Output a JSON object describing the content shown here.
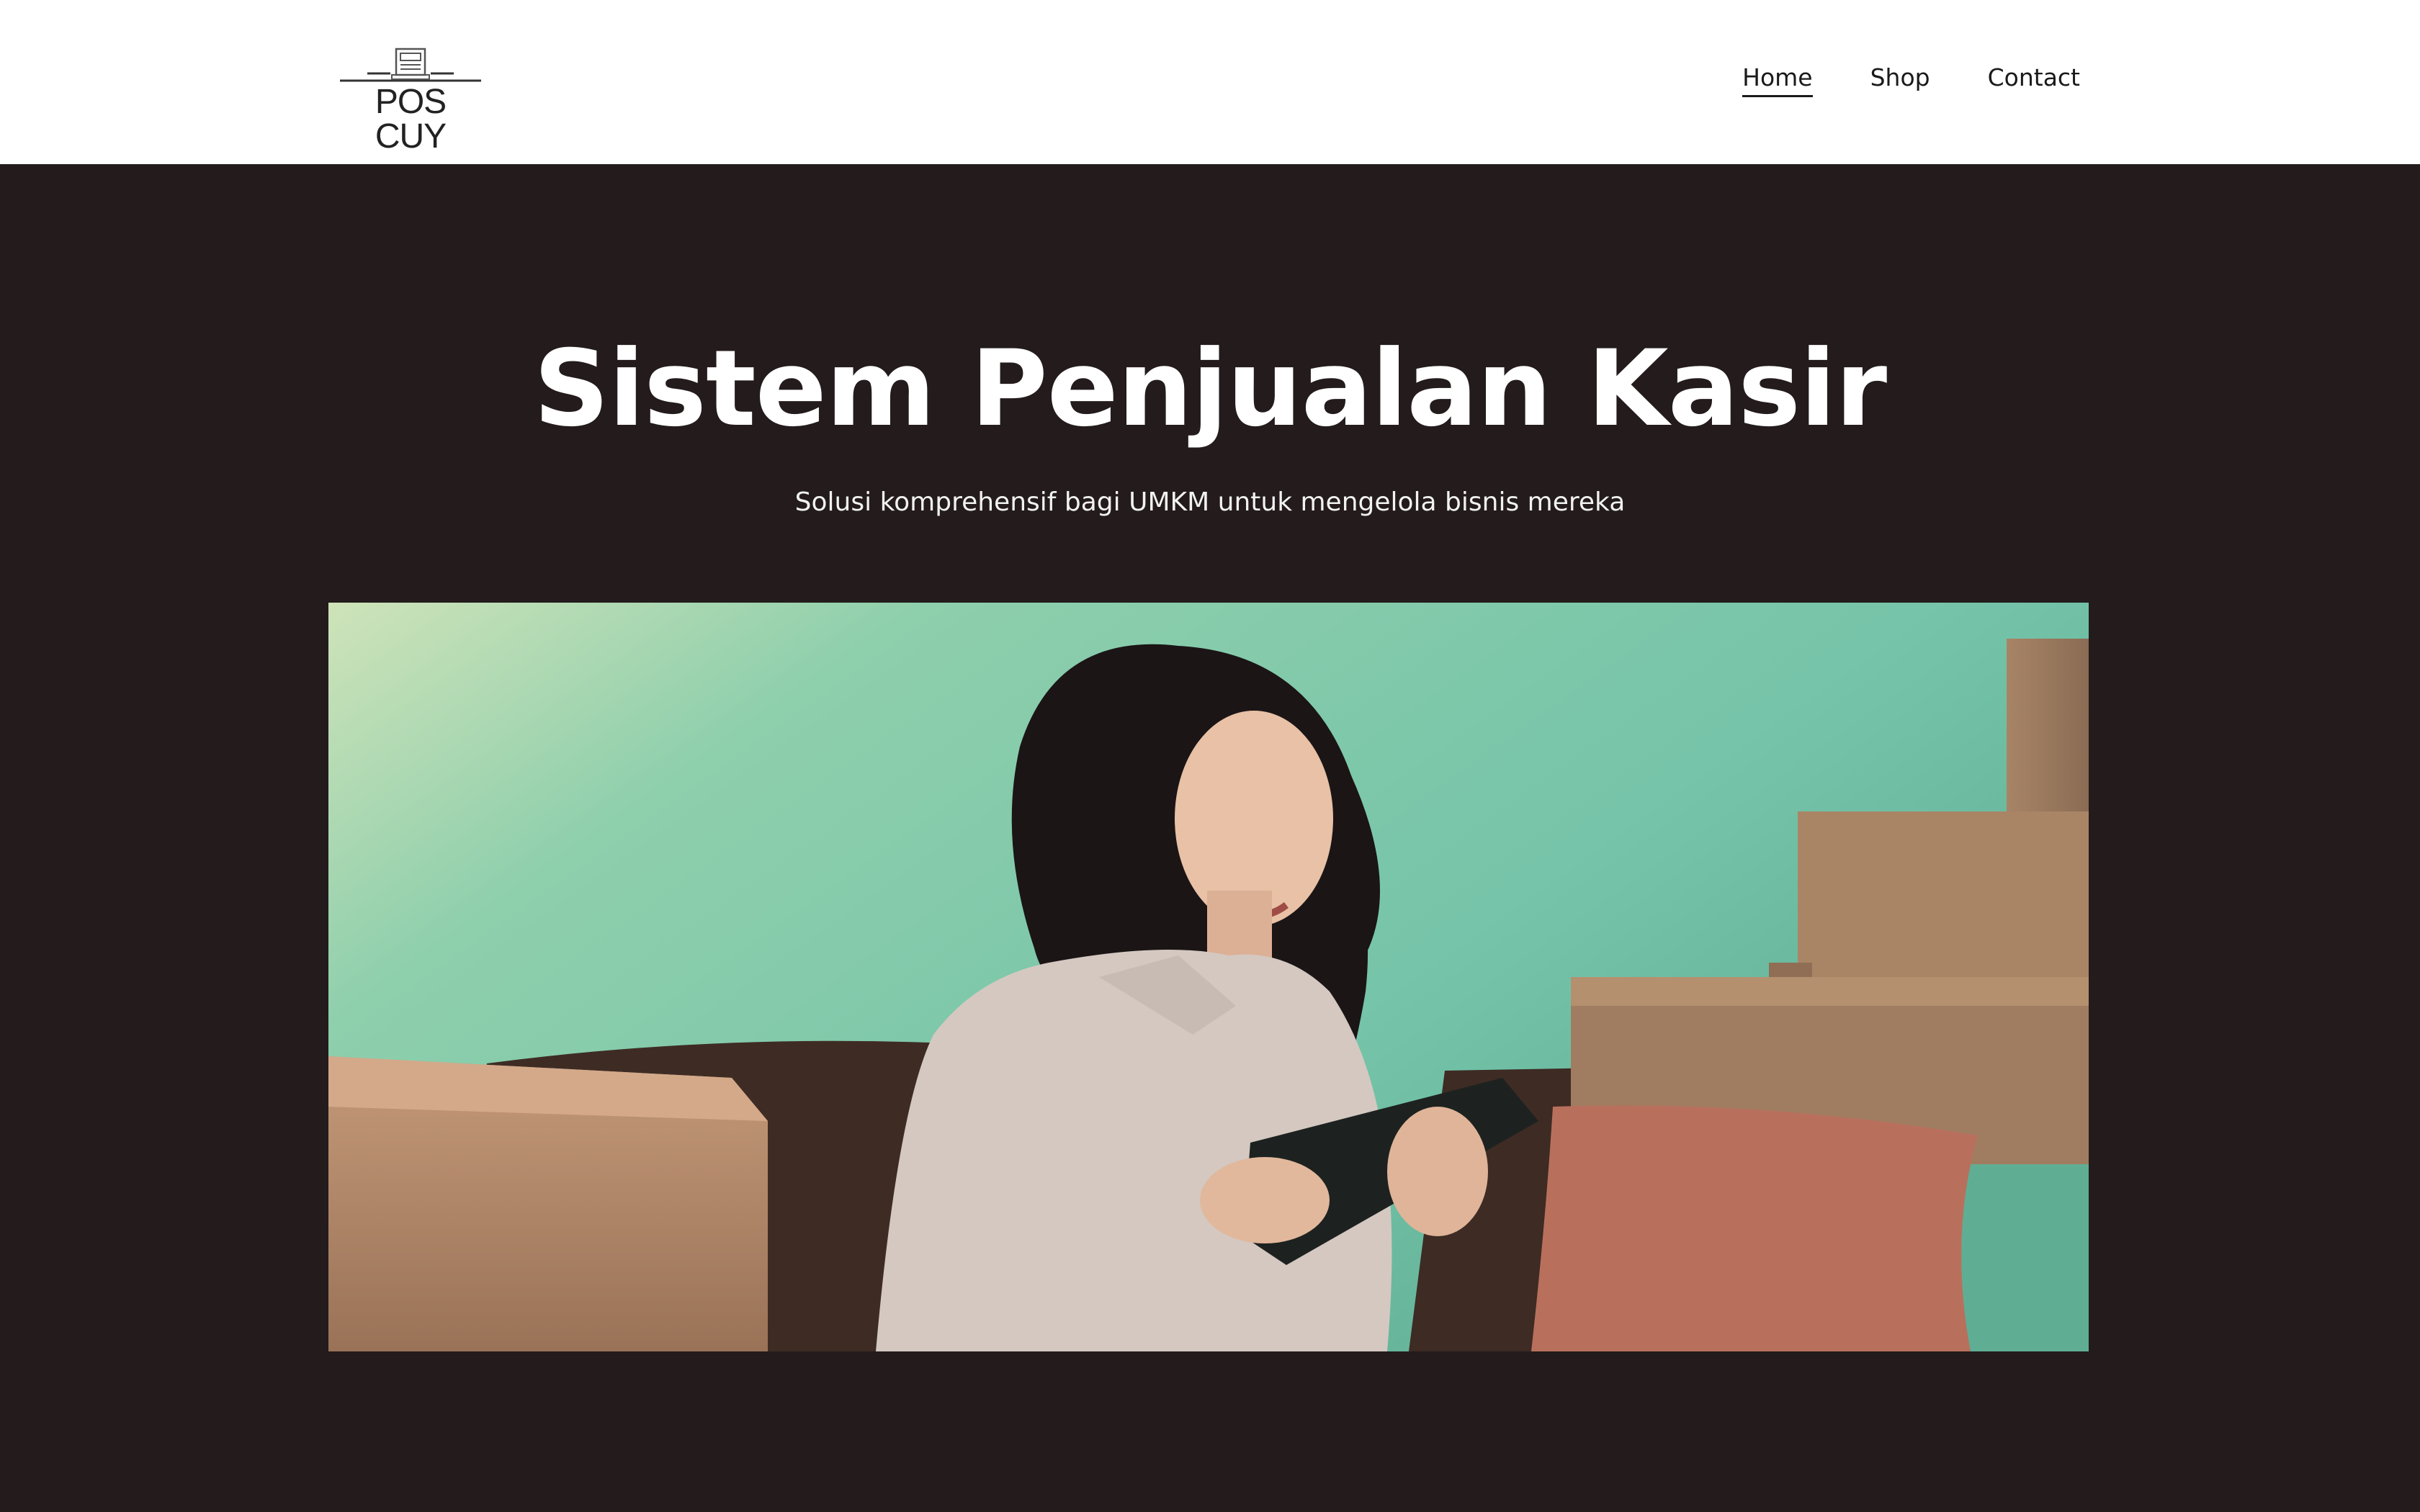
{
  "brand": {
    "name": "POS CUY",
    "logo_icon": "cash-register-icon"
  },
  "nav": {
    "items": [
      {
        "label": "Home",
        "active": true
      },
      {
        "label": "Shop",
        "active": false
      },
      {
        "label": "Contact",
        "active": false
      }
    ]
  },
  "hero": {
    "title": "Sistem Penjualan Kasir",
    "subtitle": "Solusi komprehensif bagi UMKM untuk mengelola bisnis mereka",
    "image_subject": "photo-woman-with-tablet"
  },
  "colors": {
    "header_bg": "#ffffff",
    "hero_bg": "#231b1c",
    "text_dark": "#1a1a1a",
    "text_light": "#ffffff"
  }
}
